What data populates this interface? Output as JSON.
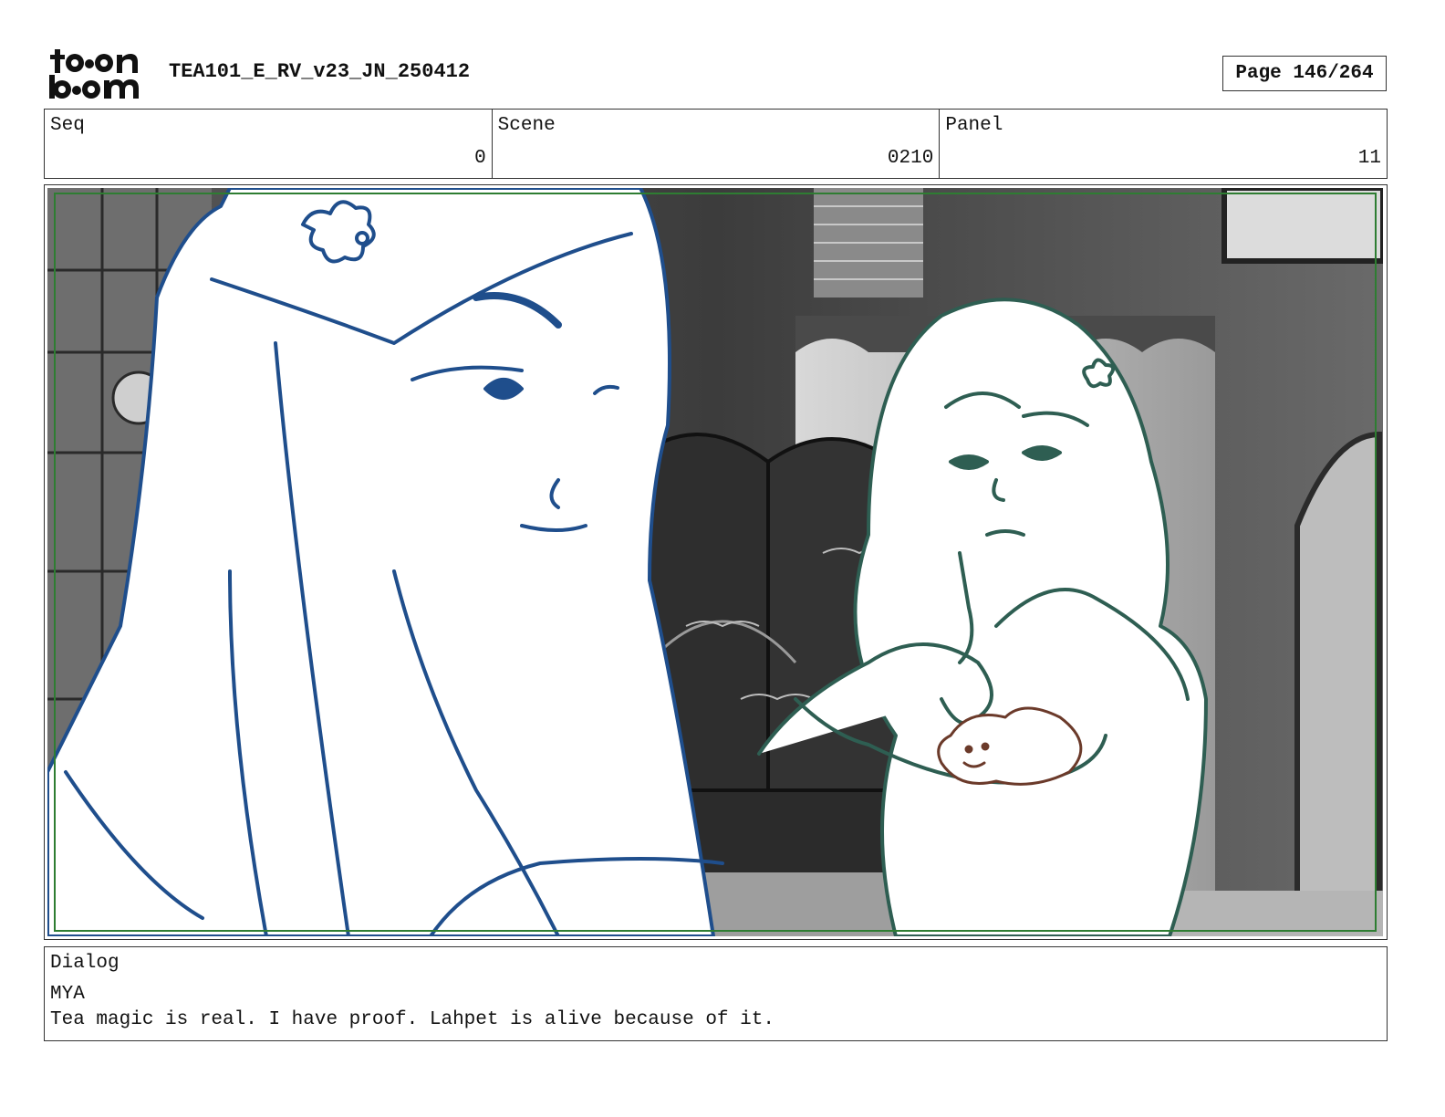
{
  "header": {
    "logo_text": "toon boom",
    "document_title": "TEA101_E_RV_v23_JN_250412",
    "page_label": "Page 146/264"
  },
  "info": {
    "seq_label": "Seq",
    "seq_value": "0",
    "scene_label": "Scene",
    "scene_value": "0210",
    "panel_label": "Panel",
    "panel_value": "11"
  },
  "panel": {
    "left_character_color": "#1f4e8c",
    "right_character_color": "#2e5e52",
    "creature_color": "#6b3a2a",
    "safe_frame_color": "#2e7d32"
  },
  "dialog": {
    "label": "Dialog",
    "speaker": "MYA",
    "line": "Tea magic is real. I have proof. Lahpet is alive because of it."
  }
}
